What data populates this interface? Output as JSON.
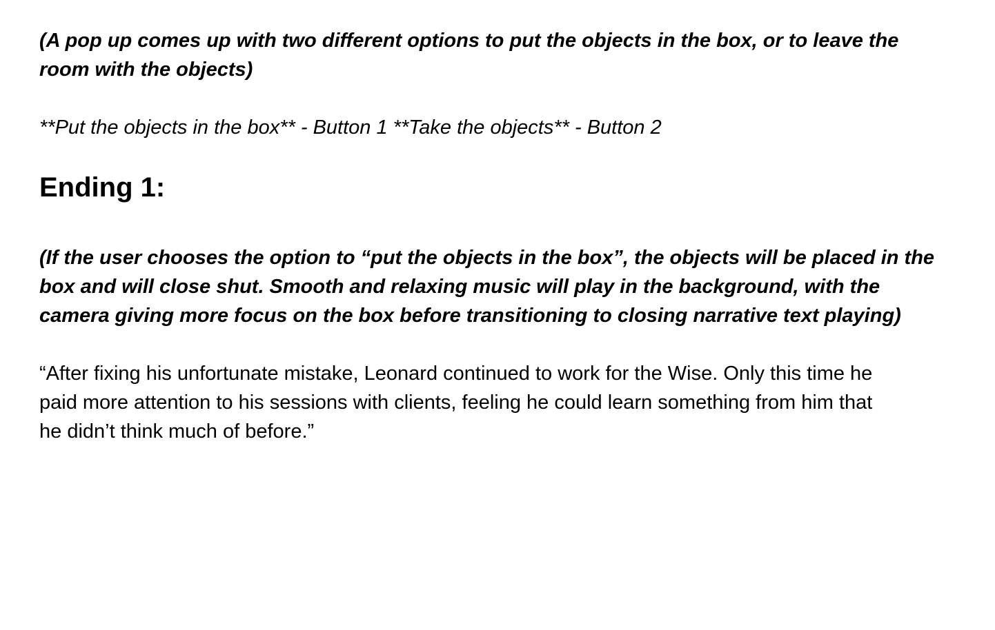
{
  "intro_direction": "(A pop up comes up with two different options to put the objects in the box, or to leave the room with the objects)",
  "options_line": "**Put the objects in the box** - Button 1 **Take the objects** - Button 2",
  "ending_heading": "Ending 1:",
  "ending_direction": "(If the user chooses the option to “put the objects in the box”, the objects will be placed in the box and will close shut. Smooth and relaxing music will play in the background, with the camera giving more focus on the box before transitioning to closing narrative text playing)",
  "closing_narrative": "“After fixing his unfortunate mistake, Leonard continued to work for the Wise. Only this time he paid more attention to his sessions with clients, feeling he could learn something from him that he didn’t think much of before.”"
}
